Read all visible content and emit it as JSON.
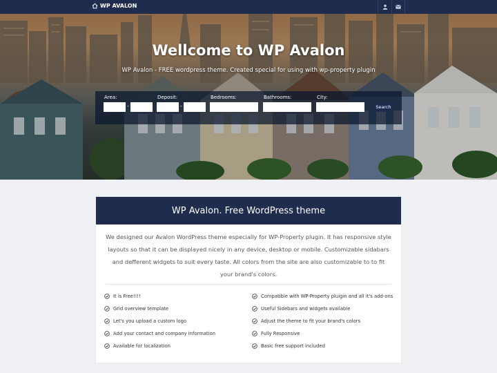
{
  "topbar": {
    "logo_text": "WP AVALON",
    "icons": [
      "home-icon",
      "user-icon",
      "envelope-icon"
    ]
  },
  "hero": {
    "title": "Wellcome to WP Avalon",
    "subtitle": "WP Avalon - FREE wordpress theme. Created special for using with wp-property plugin"
  },
  "search": {
    "area_label": "Area:",
    "deposit_label": "Deposit:",
    "bedrooms_label": "Bedrooms:",
    "bathrooms_label": "Bathrooms:",
    "city_label": "City:",
    "range_separator": "-",
    "button_label": "Search"
  },
  "card": {
    "title": "WP Avalon. Free WordPress theme",
    "description": "We designed our Avalon WordPress theme especially for WP-Property plugin. It has responsive style layouts so that it can be displayed nicely in any device, desktop or mobile. Customizable sidabars and defferent widgets to suit every taste. All colors from the site are also customizable to to fit your brand's colors.",
    "features_left": [
      "It is Free!!!!",
      "Grid overview template",
      "Let's you upload a custom logo",
      "Add your contact and company information",
      "Available for localization"
    ],
    "features_right": [
      "Compatible with WP-Property pluigin and all it's add-ons",
      "Useful Sidebars and widgets available",
      "Adjust the theme to fit your brand's colors",
      "Fully Responsive",
      "Basic free support included"
    ]
  },
  "colors": {
    "navy": "#1f2c4d",
    "page_bg": "#eef0f3"
  }
}
